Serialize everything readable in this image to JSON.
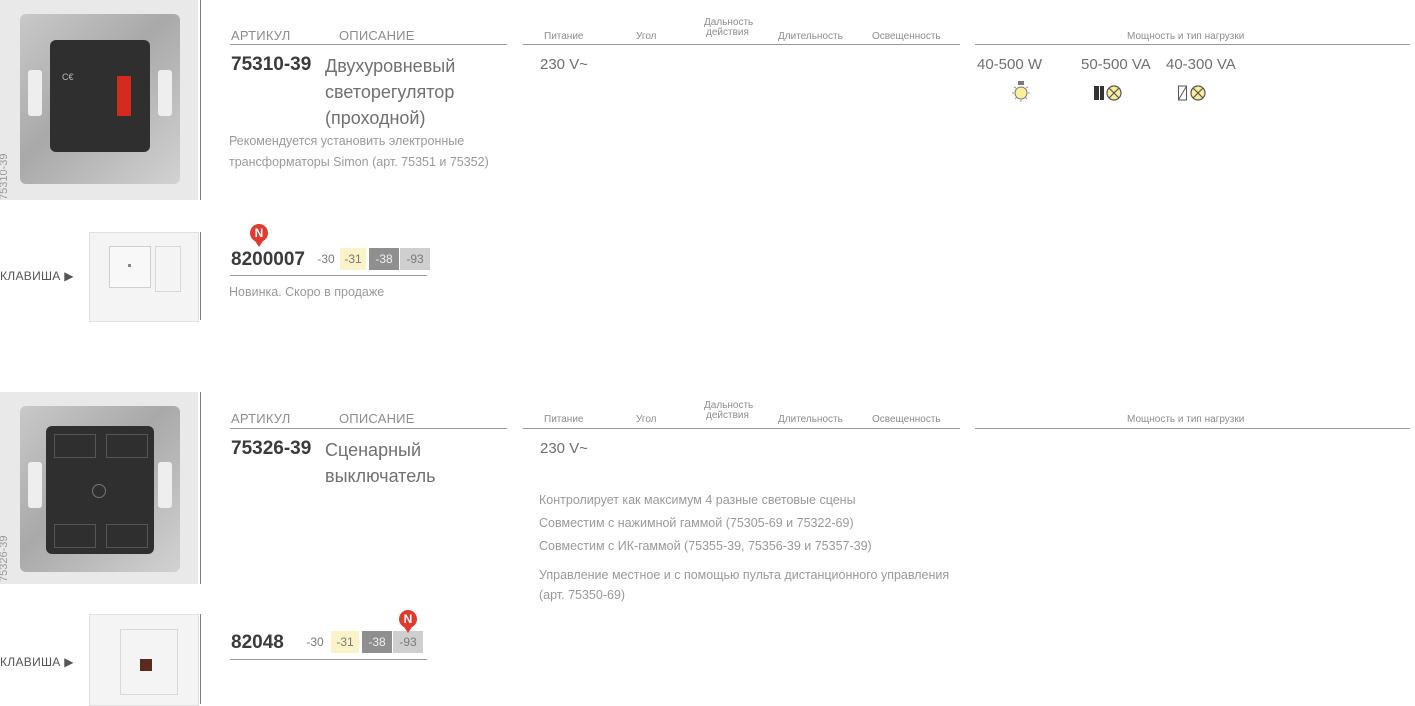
{
  "headers": {
    "article": "АРТИКУЛ",
    "description": "ОПИСАНИЕ",
    "power": "Питание",
    "angle": "Угол",
    "range_line1": "Дальность",
    "range_line2": "действия",
    "duration": "Длительность",
    "illumination": "Освещенность",
    "load": "Мощность и тип нагрузки"
  },
  "product1": {
    "side_code": "75310-39",
    "article": "75310-39",
    "desc_line1": "Двухуровневый",
    "desc_line2": "светорегулятор",
    "desc_line3": "(проходной)",
    "note_line1": "Рекомендуется установить электронные",
    "note_line2": "трансформаторы Simon (арт. 75351 и 75352)",
    "voltage": "230 V~",
    "loads": [
      {
        "value": "40-500 W",
        "icon": "incandescent-lamp-icon"
      },
      {
        "value": "50-500 VA",
        "icon": "electronic-transformer-icon"
      },
      {
        "value": "40-300 VA",
        "icon": "ferromagnetic-transformer-icon"
      }
    ],
    "key_label": "КЛАВИША ▶",
    "key_article": "8200007",
    "key_variants": [
      "-30",
      "-31",
      "-38",
      "-93"
    ],
    "key_note": "Новинка. Скоро в продаже",
    "new_mark": "N"
  },
  "product2": {
    "side_code": "75326-39",
    "article": "75326-39",
    "desc_line1": "Сценарный",
    "desc_line2": "выключатель",
    "voltage": "230 V~",
    "features": [
      "Контролирует как максимум 4 разные световые сцены",
      "Совместим с нажимной гаммой (75305-69 и 75322-69)",
      "Совместим с ИК-гаммой (75355-39, 75356-39 и 75357-39)",
      "Управление местное и с помощью пульта дистанционного управления",
      "(арт. 75350-69)"
    ],
    "key_label": "КЛАВИША ▶",
    "key_article": "82048",
    "key_variants": [
      "-30",
      "-31",
      "-38",
      "-93"
    ],
    "new_mark": "N"
  },
  "colors": {
    "variant_30": "#ffffff",
    "variant_31": "#fbf3c8",
    "variant_38": "#8f8f8f",
    "variant_93": "#cfcfcf",
    "new_mark": "#e23b2e"
  }
}
